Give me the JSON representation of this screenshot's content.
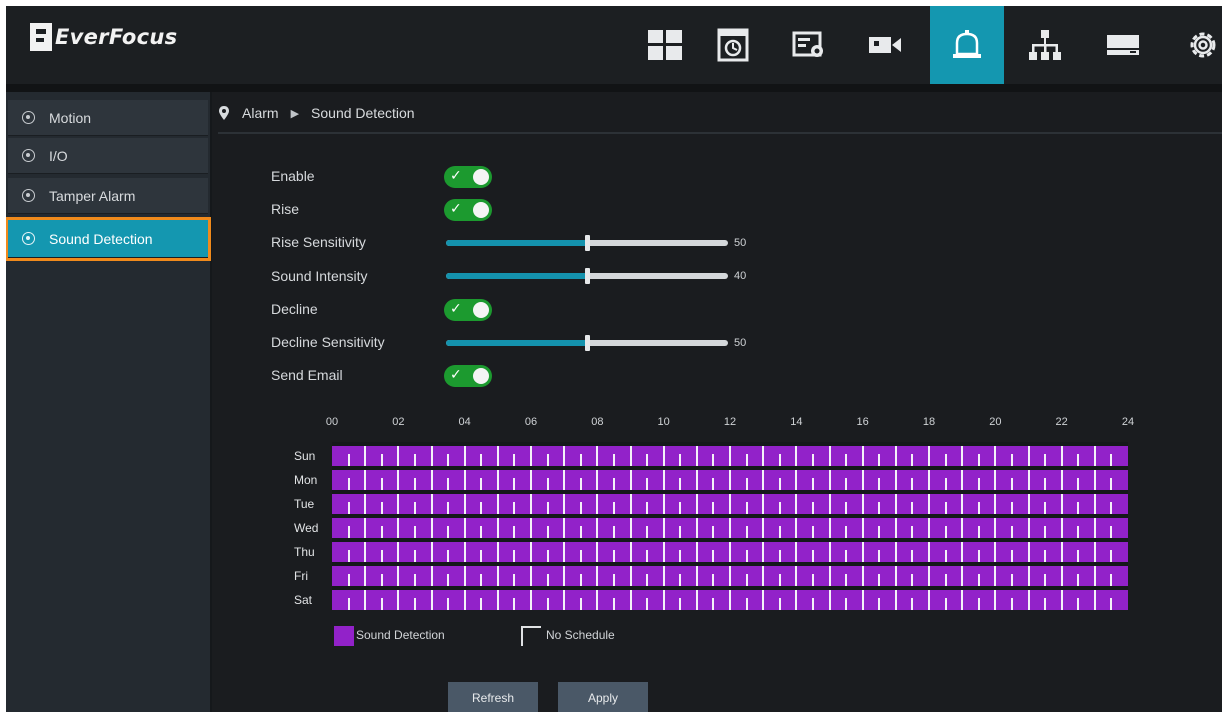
{
  "app": {
    "brand": "EverFocus"
  },
  "topnav": {
    "items": [
      {
        "name": "live-view",
        "icon": "grid-icon"
      },
      {
        "name": "playback",
        "icon": "playback-icon"
      },
      {
        "name": "image",
        "icon": "image-settings-icon"
      },
      {
        "name": "camera",
        "icon": "camera-icon"
      },
      {
        "name": "alarm",
        "icon": "alarm-bell-icon",
        "active": true
      },
      {
        "name": "network",
        "icon": "network-icon"
      },
      {
        "name": "storage",
        "icon": "storage-icon"
      },
      {
        "name": "system",
        "icon": "gear-icon"
      }
    ],
    "active_color": "#1497b0"
  },
  "sidebar": {
    "items": [
      {
        "label": "Motion"
      },
      {
        "label": "I/O"
      },
      {
        "label": "Tamper Alarm"
      },
      {
        "label": "Sound Detection",
        "active": true
      }
    ]
  },
  "breadcrumb": {
    "root": "Alarm",
    "current": "Sound Detection"
  },
  "settings": {
    "enable": {
      "label": "Enable",
      "on": true
    },
    "rise": {
      "label": "Rise",
      "on": true
    },
    "rise_sensitivity": {
      "label": "Rise Sensitivity",
      "value": "50",
      "fraction": 0.5
    },
    "sound_intensity": {
      "label": "Sound Intensity",
      "value": "40",
      "fraction": 0.5
    },
    "decline": {
      "label": "Decline",
      "on": true
    },
    "decline_sensitivity": {
      "label": "Decline Sensitivity",
      "value": "50",
      "fraction": 0.5
    },
    "send_email": {
      "label": "Send Email",
      "on": true
    }
  },
  "schedule": {
    "hours": [
      "00",
      "02",
      "04",
      "06",
      "08",
      "10",
      "12",
      "14",
      "16",
      "18",
      "20",
      "22",
      "24"
    ],
    "days": [
      "Sun",
      "Mon",
      "Tue",
      "Wed",
      "Thu",
      "Fri",
      "Sat"
    ],
    "fill_color": "#9222c9"
  },
  "legend": {
    "sound_detection": "Sound Detection",
    "no_schedule": "No Schedule"
  },
  "buttons": {
    "refresh": "Refresh",
    "apply": "Apply"
  }
}
